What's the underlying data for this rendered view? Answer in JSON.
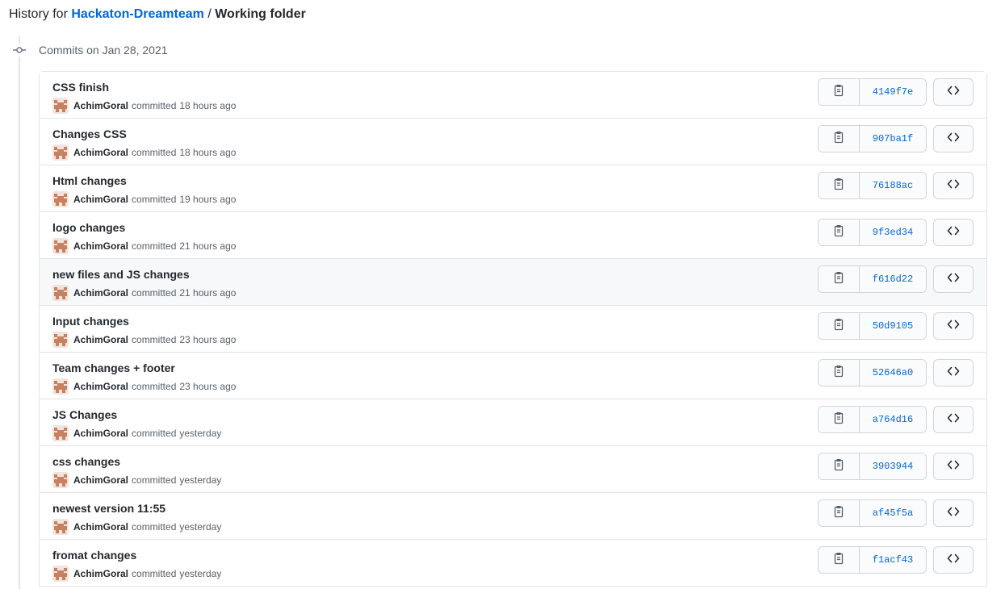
{
  "header": {
    "prefix": "History for",
    "repo_name": "Hackaton-Dreamteam",
    "separator": "/",
    "folder": "Working folder"
  },
  "group": {
    "heading": "Commits on Jan 28, 2021"
  },
  "icons": {
    "commit": "git-commit-icon",
    "copy": "clipboard-icon",
    "browse": "code-icon",
    "avatar": "identicon-avatar"
  },
  "colors": {
    "link": "#0366d6",
    "avatar_fill": "#c9805f",
    "avatar_bg": "#f0e4de",
    "row_hover": "#f6f8fa"
  },
  "commits": [
    {
      "message": "CSS finish",
      "author": "AchimGoral",
      "verb": "committed",
      "time": "18 hours ago",
      "sha": "4149f7e"
    },
    {
      "message": "Changes CSS",
      "author": "AchimGoral",
      "verb": "committed",
      "time": "18 hours ago",
      "sha": "907ba1f"
    },
    {
      "message": "Html changes",
      "author": "AchimGoral",
      "verb": "committed",
      "time": "19 hours ago",
      "sha": "76188ac"
    },
    {
      "message": "logo changes",
      "author": "AchimGoral",
      "verb": "committed",
      "time": "21 hours ago",
      "sha": "9f3ed34"
    },
    {
      "message": "new files and JS changes",
      "author": "AchimGoral",
      "verb": "committed",
      "time": "21 hours ago",
      "sha": "f616d22",
      "hover": true
    },
    {
      "message": "Input changes",
      "author": "AchimGoral",
      "verb": "committed",
      "time": "23 hours ago",
      "sha": "50d9105"
    },
    {
      "message": "Team changes + footer",
      "author": "AchimGoral",
      "verb": "committed",
      "time": "23 hours ago",
      "sha": "52646a0"
    },
    {
      "message": "JS Changes",
      "author": "AchimGoral",
      "verb": "committed",
      "time": "yesterday",
      "sha": "a764d16"
    },
    {
      "message": "css changes",
      "author": "AchimGoral",
      "verb": "committed",
      "time": "yesterday",
      "sha": "3903944"
    },
    {
      "message": "newest version 11:55",
      "author": "AchimGoral",
      "verb": "committed",
      "time": "yesterday",
      "sha": "af45f5a"
    },
    {
      "message": "fromat changes",
      "author": "AchimGoral",
      "verb": "committed",
      "time": "yesterday",
      "sha": "f1acf43"
    }
  ]
}
